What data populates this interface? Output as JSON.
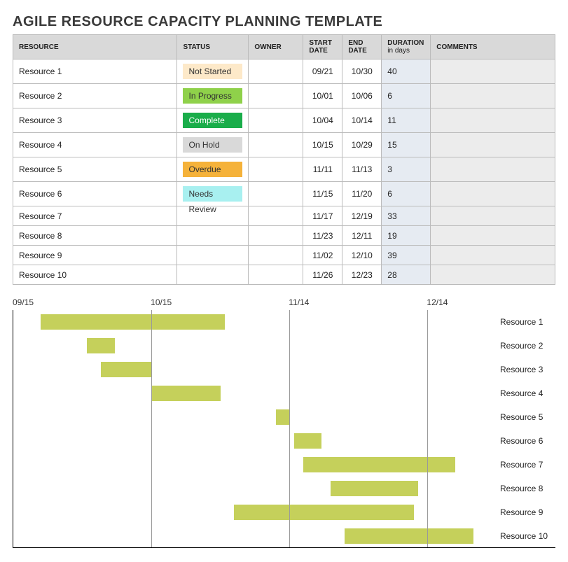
{
  "title": "AGILE RESOURCE CAPACITY PLANNING TEMPLATE",
  "columns": {
    "resource": "RESOURCE",
    "status": "STATUS",
    "owner": "OWNER",
    "start": "START DATE",
    "end": "END DATE",
    "duration": "DURATION",
    "duration_sub": "in days",
    "comments": "COMMENTS"
  },
  "status_styles": {
    "Not Started": {
      "bg": "#fde9c9",
      "fg": "#333"
    },
    "In Progress": {
      "bg": "#8fd14a",
      "fg": "#333"
    },
    "Complete": {
      "bg": "#1aad4a",
      "fg": "#fff"
    },
    "On Hold": {
      "bg": "#d9d9d9",
      "fg": "#333"
    },
    "Overdue": {
      "bg": "#f5b23a",
      "fg": "#333"
    },
    "Needs Review": {
      "bg": "#a8f0f0",
      "fg": "#333"
    }
  },
  "rows": [
    {
      "resource": "Resource 1",
      "status": "Not Started",
      "owner": "",
      "start": "09/21",
      "end": "10/30",
      "duration": "40",
      "comments": ""
    },
    {
      "resource": "Resource 2",
      "status": "In Progress",
      "owner": "",
      "start": "10/01",
      "end": "10/06",
      "duration": "6",
      "comments": ""
    },
    {
      "resource": "Resource 3",
      "status": "Complete",
      "owner": "",
      "start": "10/04",
      "end": "10/14",
      "duration": "11",
      "comments": ""
    },
    {
      "resource": "Resource 4",
      "status": "On Hold",
      "owner": "",
      "start": "10/15",
      "end": "10/29",
      "duration": "15",
      "comments": ""
    },
    {
      "resource": "Resource 5",
      "status": "Overdue",
      "owner": "",
      "start": "11/11",
      "end": "11/13",
      "duration": "3",
      "comments": ""
    },
    {
      "resource": "Resource 6",
      "status": "Needs Review",
      "owner": "",
      "start": "11/15",
      "end": "11/20",
      "duration": "6",
      "comments": ""
    },
    {
      "resource": "Resource 7",
      "status": "",
      "owner": "",
      "start": "11/17",
      "end": "12/19",
      "duration": "33",
      "comments": ""
    },
    {
      "resource": "Resource 8",
      "status": "",
      "owner": "",
      "start": "11/23",
      "end": "12/11",
      "duration": "19",
      "comments": ""
    },
    {
      "resource": "Resource 9",
      "status": "",
      "owner": "",
      "start": "11/02",
      "end": "12/10",
      "duration": "39",
      "comments": ""
    },
    {
      "resource": "Resource 10",
      "status": "",
      "owner": "",
      "start": "11/26",
      "end": "12/23",
      "duration": "28",
      "comments": ""
    }
  ],
  "chart_data": {
    "type": "bar",
    "orientation": "horizontal-gantt",
    "x_axis_ticks": [
      "09/15",
      "10/15",
      "11/14",
      "12/14"
    ],
    "x_range_days": [
      0,
      105
    ],
    "bar_color": "#c5d05b",
    "series": [
      {
        "name": "Resource 1",
        "start_offset_days": 6,
        "duration_days": 40
      },
      {
        "name": "Resource 2",
        "start_offset_days": 16,
        "duration_days": 6
      },
      {
        "name": "Resource 3",
        "start_offset_days": 19,
        "duration_days": 11
      },
      {
        "name": "Resource 4",
        "start_offset_days": 30,
        "duration_days": 15
      },
      {
        "name": "Resource 5",
        "start_offset_days": 57,
        "duration_days": 3
      },
      {
        "name": "Resource 6",
        "start_offset_days": 61,
        "duration_days": 6
      },
      {
        "name": "Resource 7",
        "start_offset_days": 63,
        "duration_days": 33
      },
      {
        "name": "Resource 8",
        "start_offset_days": 69,
        "duration_days": 19
      },
      {
        "name": "Resource 9",
        "start_offset_days": 48,
        "duration_days": 39
      },
      {
        "name": "Resource 10",
        "start_offset_days": 72,
        "duration_days": 28
      }
    ]
  }
}
